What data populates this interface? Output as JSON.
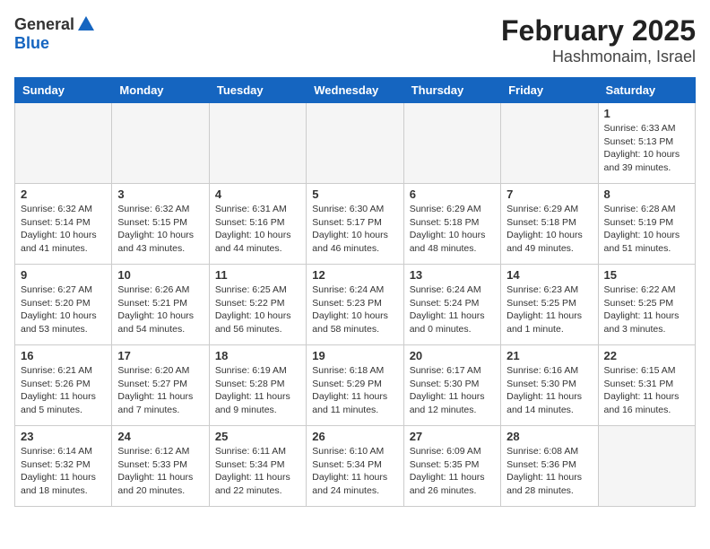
{
  "header": {
    "logo_general": "General",
    "logo_blue": "Blue",
    "title": "February 2025",
    "subtitle": "Hashmonaim, Israel"
  },
  "days_of_week": [
    "Sunday",
    "Monday",
    "Tuesday",
    "Wednesday",
    "Thursday",
    "Friday",
    "Saturday"
  ],
  "weeks": [
    [
      {
        "day": "",
        "info": ""
      },
      {
        "day": "",
        "info": ""
      },
      {
        "day": "",
        "info": ""
      },
      {
        "day": "",
        "info": ""
      },
      {
        "day": "",
        "info": ""
      },
      {
        "day": "",
        "info": ""
      },
      {
        "day": "1",
        "info": "Sunrise: 6:33 AM\nSunset: 5:13 PM\nDaylight: 10 hours and 39 minutes."
      }
    ],
    [
      {
        "day": "2",
        "info": "Sunrise: 6:32 AM\nSunset: 5:14 PM\nDaylight: 10 hours and 41 minutes."
      },
      {
        "day": "3",
        "info": "Sunrise: 6:32 AM\nSunset: 5:15 PM\nDaylight: 10 hours and 43 minutes."
      },
      {
        "day": "4",
        "info": "Sunrise: 6:31 AM\nSunset: 5:16 PM\nDaylight: 10 hours and 44 minutes."
      },
      {
        "day": "5",
        "info": "Sunrise: 6:30 AM\nSunset: 5:17 PM\nDaylight: 10 hours and 46 minutes."
      },
      {
        "day": "6",
        "info": "Sunrise: 6:29 AM\nSunset: 5:18 PM\nDaylight: 10 hours and 48 minutes."
      },
      {
        "day": "7",
        "info": "Sunrise: 6:29 AM\nSunset: 5:18 PM\nDaylight: 10 hours and 49 minutes."
      },
      {
        "day": "8",
        "info": "Sunrise: 6:28 AM\nSunset: 5:19 PM\nDaylight: 10 hours and 51 minutes."
      }
    ],
    [
      {
        "day": "9",
        "info": "Sunrise: 6:27 AM\nSunset: 5:20 PM\nDaylight: 10 hours and 53 minutes."
      },
      {
        "day": "10",
        "info": "Sunrise: 6:26 AM\nSunset: 5:21 PM\nDaylight: 10 hours and 54 minutes."
      },
      {
        "day": "11",
        "info": "Sunrise: 6:25 AM\nSunset: 5:22 PM\nDaylight: 10 hours and 56 minutes."
      },
      {
        "day": "12",
        "info": "Sunrise: 6:24 AM\nSunset: 5:23 PM\nDaylight: 10 hours and 58 minutes."
      },
      {
        "day": "13",
        "info": "Sunrise: 6:24 AM\nSunset: 5:24 PM\nDaylight: 11 hours and 0 minutes."
      },
      {
        "day": "14",
        "info": "Sunrise: 6:23 AM\nSunset: 5:25 PM\nDaylight: 11 hours and 1 minute."
      },
      {
        "day": "15",
        "info": "Sunrise: 6:22 AM\nSunset: 5:25 PM\nDaylight: 11 hours and 3 minutes."
      }
    ],
    [
      {
        "day": "16",
        "info": "Sunrise: 6:21 AM\nSunset: 5:26 PM\nDaylight: 11 hours and 5 minutes."
      },
      {
        "day": "17",
        "info": "Sunrise: 6:20 AM\nSunset: 5:27 PM\nDaylight: 11 hours and 7 minutes."
      },
      {
        "day": "18",
        "info": "Sunrise: 6:19 AM\nSunset: 5:28 PM\nDaylight: 11 hours and 9 minutes."
      },
      {
        "day": "19",
        "info": "Sunrise: 6:18 AM\nSunset: 5:29 PM\nDaylight: 11 hours and 11 minutes."
      },
      {
        "day": "20",
        "info": "Sunrise: 6:17 AM\nSunset: 5:30 PM\nDaylight: 11 hours and 12 minutes."
      },
      {
        "day": "21",
        "info": "Sunrise: 6:16 AM\nSunset: 5:30 PM\nDaylight: 11 hours and 14 minutes."
      },
      {
        "day": "22",
        "info": "Sunrise: 6:15 AM\nSunset: 5:31 PM\nDaylight: 11 hours and 16 minutes."
      }
    ],
    [
      {
        "day": "23",
        "info": "Sunrise: 6:14 AM\nSunset: 5:32 PM\nDaylight: 11 hours and 18 minutes."
      },
      {
        "day": "24",
        "info": "Sunrise: 6:12 AM\nSunset: 5:33 PM\nDaylight: 11 hours and 20 minutes."
      },
      {
        "day": "25",
        "info": "Sunrise: 6:11 AM\nSunset: 5:34 PM\nDaylight: 11 hours and 22 minutes."
      },
      {
        "day": "26",
        "info": "Sunrise: 6:10 AM\nSunset: 5:34 PM\nDaylight: 11 hours and 24 minutes."
      },
      {
        "day": "27",
        "info": "Sunrise: 6:09 AM\nSunset: 5:35 PM\nDaylight: 11 hours and 26 minutes."
      },
      {
        "day": "28",
        "info": "Sunrise: 6:08 AM\nSunset: 5:36 PM\nDaylight: 11 hours and 28 minutes."
      },
      {
        "day": "",
        "info": ""
      }
    ]
  ]
}
